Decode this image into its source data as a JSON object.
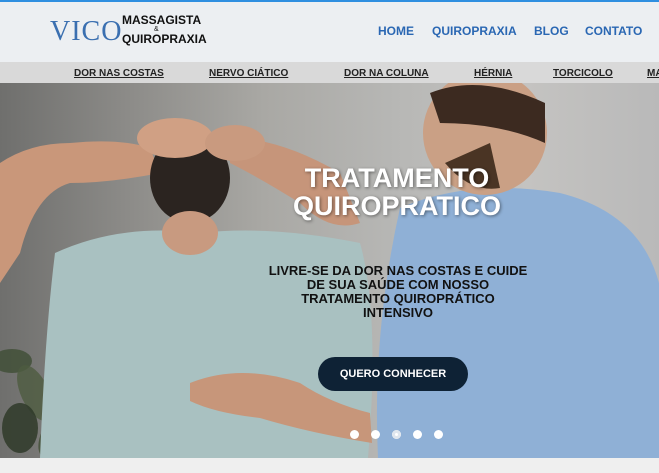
{
  "brand": {
    "vico": "VICO",
    "line1": "MASSAGISTA",
    "amp": "&",
    "line2": "QUIROPRAXIA"
  },
  "nav": {
    "home": "HOME",
    "quiropraxia": "QUIROPRAXIA",
    "blog": "BLOG",
    "contato": "CONTATO"
  },
  "subnav": [
    "DOR NAS COSTAS",
    "NERVO CIÁTICO",
    "DOR NA COLUNA",
    "HÉRNIA",
    "TORCICOLO",
    "MA"
  ],
  "hero": {
    "title_line1": "TRATAMENTO",
    "title_line2": "QUIROPRATICO",
    "subtitle": "LIVRE-SE DA DOR NAS COSTAS E CUIDE DE SUA SAÚDE COM NOSSO TRATAMENTO QUIROPRÁTICO INTENSIVO",
    "cta": "QUERO CONHECER"
  },
  "carousel": {
    "dot_count": 5,
    "active_index": 2
  },
  "colors": {
    "accent": "#2a67b3",
    "cta_bg": "#0e2235",
    "topline": "#2f8fe0"
  }
}
